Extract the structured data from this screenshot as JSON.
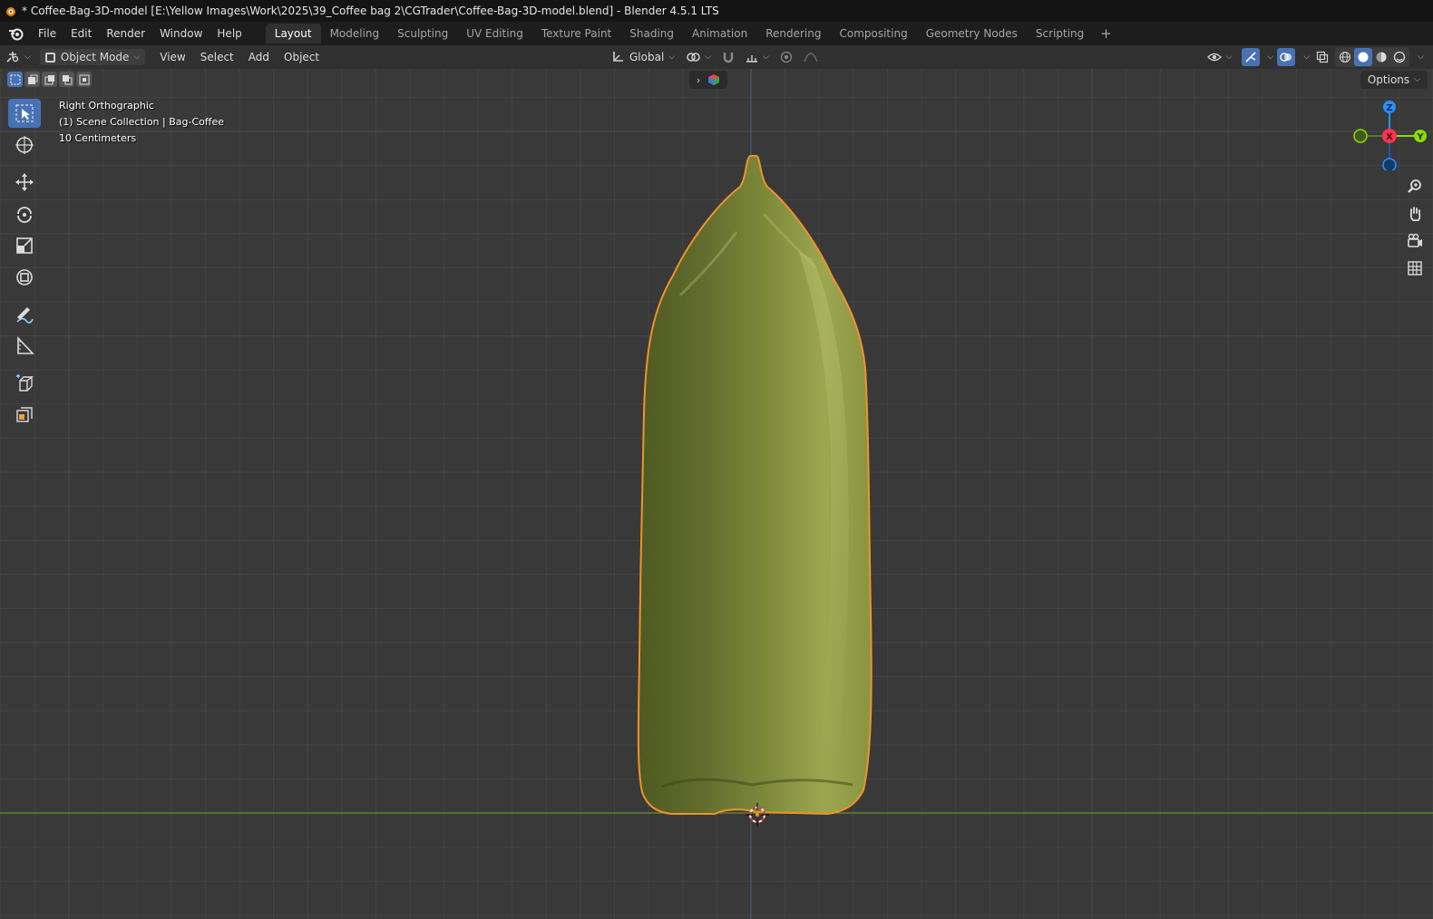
{
  "window": {
    "title": "* Coffee-Bag-3D-model [E:\\Yellow Images\\Work\\2025\\39_Coffee bag 2\\CGTrader\\Coffee-Bag-3D-model.blend] - Blender 4.5.1 LTS"
  },
  "menu": {
    "items": [
      "File",
      "Edit",
      "Render",
      "Window",
      "Help"
    ]
  },
  "workspaces": {
    "tabs": [
      "Layout",
      "Modeling",
      "Sculpting",
      "UV Editing",
      "Texture Paint",
      "Shading",
      "Animation",
      "Rendering",
      "Compositing",
      "Geometry Nodes",
      "Scripting"
    ],
    "active": "Layout",
    "add_icon": "plus-icon"
  },
  "header": {
    "mode": "Object Mode",
    "menus": [
      "View",
      "Select",
      "Add",
      "Object"
    ],
    "transform_orientation": "Global",
    "options_label": "Options"
  },
  "viewport": {
    "view_name": "Right Orthographic",
    "collection": "(1) Scene Collection | Bag-Coffee",
    "scale": "10 Centimeters",
    "background": "#393939",
    "grid_color": "#444444",
    "floor_line_color": "#6b8f2e",
    "selection_outline": "#f0922b",
    "object_color": "#8a9440"
  },
  "gizmo": {
    "axes": [
      "Z",
      "X",
      "Y"
    ],
    "colors": {
      "x": "#ff3352",
      "y": "#8bdc00",
      "z": "#2890ff"
    }
  },
  "toolbar": {
    "tools": [
      "select-box-icon",
      "cursor-icon",
      "move-icon",
      "rotate-icon",
      "scale-icon",
      "transform-icon",
      "annotate-icon",
      "measure-icon",
      "add-cube-icon",
      "scale-cage-icon"
    ],
    "active": "select-box-icon"
  },
  "navigation": {
    "buttons": [
      "zoom-icon",
      "pan-hand-icon",
      "camera-icon",
      "perspective-grid-icon"
    ]
  }
}
